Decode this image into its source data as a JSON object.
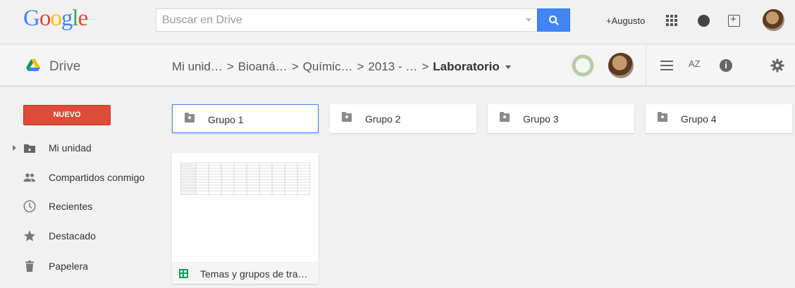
{
  "topbar": {
    "logo": "Google",
    "search_placeholder": "Buscar en Drive",
    "user_link": "+Augusto"
  },
  "drivebar": {
    "title": "Drive",
    "breadcrumbs": [
      "Mi unid…",
      "Bioaná…",
      "Químic…",
      "2013 - …"
    ],
    "current_folder": "Laboratorio",
    "separator": ">",
    "sort_label": "AZ",
    "info_label": "i"
  },
  "sidebar": {
    "new_button": "NUEVO",
    "items": [
      {
        "label": "Mi unidad",
        "icon": "drive-folder-icon"
      },
      {
        "label": "Compartidos conmigo",
        "icon": "people-icon"
      },
      {
        "label": "Recientes",
        "icon": "clock-icon"
      },
      {
        "label": "Destacado",
        "icon": "star-icon"
      },
      {
        "label": "Papelera",
        "icon": "trash-icon"
      }
    ]
  },
  "main": {
    "folders": [
      {
        "name": "Grupo 1",
        "selected": true
      },
      {
        "name": "Grupo 2",
        "selected": false
      },
      {
        "name": "Grupo 3",
        "selected": false
      },
      {
        "name": "Grupo 4",
        "selected": false
      }
    ],
    "files": [
      {
        "name": "Temas y grupos de tra…",
        "type": "spreadsheet"
      }
    ]
  },
  "colors": {
    "accent_blue": "#4285f4",
    "new_button_red": "#dd4b39",
    "sheets_green": "#0f9d58"
  }
}
